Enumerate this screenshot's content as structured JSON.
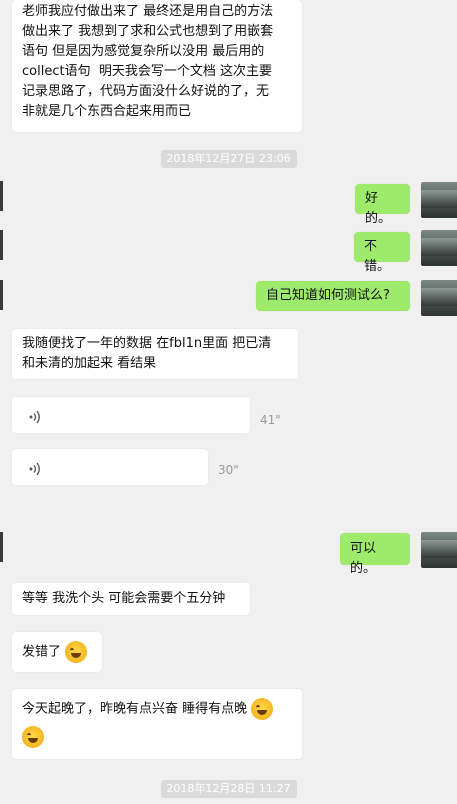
{
  "messages": {
    "m1": "老师我应付做出来了 最终还是用自己的方法\n做出来了 我想到了求和公式也想到了用嵌套\n语句 但是因为感觉复杂所以没用 最后用的\ncollect语句  明天我会写一个文档 这次主要\n记录思路了，代码方面没什么好说的了，无\n非就是几个东西合起来用而已",
    "m2": "好的。",
    "m3": "不错。",
    "m4": "自己知道如何测试么?",
    "m5": "我随便找了一年的数据 在fbl1n里面 把已清\n和未清的加起来 看结果",
    "m8": "可以的。",
    "m9": "等等 我洗个头 可能会需要个五分钟",
    "m10": "发错了",
    "m11": "今天起晚了，昨晚有点兴奋 睡得有点晚"
  },
  "timestamps": {
    "t1": "2018年12月27日 23:06",
    "t2": "2018年12月28日 11:27"
  },
  "voice": {
    "v1_duration": "41\"",
    "v2_duration": "30\""
  },
  "emoji": {
    "laugh_cry": "laughing-crying-face",
    "facepalm": "facepalm-face"
  }
}
